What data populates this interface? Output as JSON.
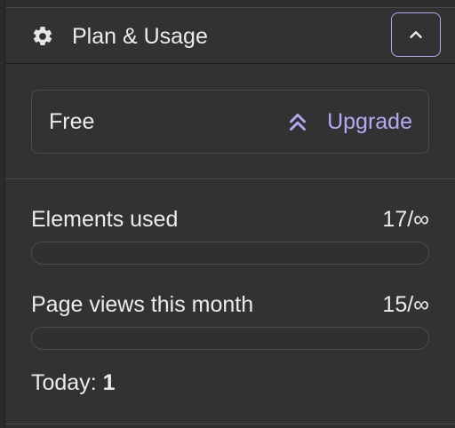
{
  "header": {
    "title": "Plan & Usage",
    "icon": "gear-icon",
    "collapse_icon": "chevron-up-icon"
  },
  "plan": {
    "name": "Free",
    "upgrade_label": "Upgrade",
    "upgrade_icon": "double-chevron-up-icon"
  },
  "usage": {
    "elements": {
      "label": "Elements used",
      "value": "17/∞",
      "progress": 0
    },
    "page_views": {
      "label": "Page views this month",
      "value": "15/∞",
      "progress": 0
    },
    "today_label": "Today: ",
    "today_count": "1"
  },
  "colors": {
    "accent": "#b5a8f5",
    "panel_bg": "#323232",
    "border": "#4c4c4c",
    "text": "#ececec"
  }
}
